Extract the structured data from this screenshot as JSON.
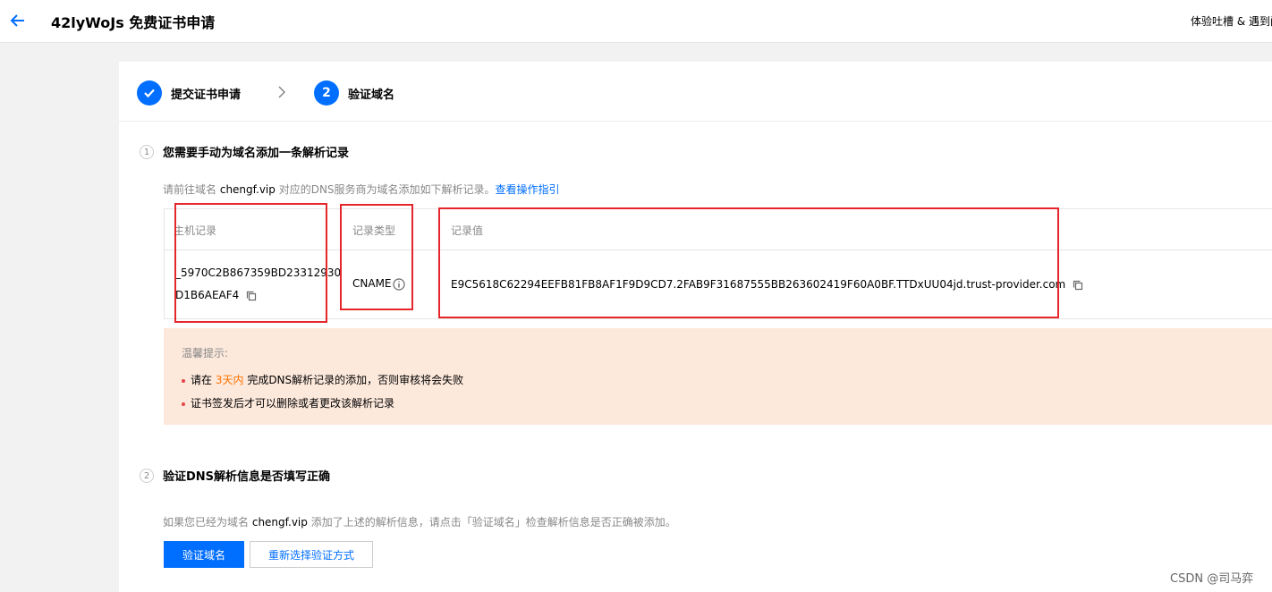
{
  "header": {
    "title": "42lyWoJs 免费证书申请",
    "feedback": "体验吐槽 & 遇到问"
  },
  "steps": [
    {
      "label": "提交证书申请",
      "state": "done"
    },
    {
      "number": "2",
      "label": "验证域名",
      "state": "active"
    }
  ],
  "section1": {
    "number": "1",
    "title": "您需要手动为域名添加一条解析记录",
    "hint_prefix": "请前往域名",
    "domain": "chengf.vip",
    "hint_suffix": "对应的DNS服务商为域名添加如下解析记录。",
    "guide_link": "查看操作指引",
    "table": {
      "headers": {
        "host": "主机记录",
        "type": "记录类型",
        "value": "记录值"
      },
      "row": {
        "host_line1": "_5970C2B867359BD23312930",
        "host_line2": "D1B6AEAF4",
        "type": "CNAME",
        "value": "E9C5618C62294EEFB81FB8AF1F9D9CD7.2FAB9F31687555BB263602419F60A0BF.TTDxUU04jd.trust-provider.com"
      }
    }
  },
  "tips": {
    "title": "温馨提示:",
    "item1_prefix": "请在",
    "item1_highlight": "3天内",
    "item1_suffix": "完成DNS解析记录的添加，否则审核将会失败",
    "item2": "证书签发后才可以删除或者更改该解析记录"
  },
  "section2": {
    "number": "2",
    "title": "验证DNS解析信息是否填写正确",
    "hint_prefix": "如果您已经为域名",
    "domain": "chengf.vip",
    "hint_suffix": "添加了上述的解析信息，请点击「验证域名」检查解析信息是否正确被添加。",
    "verify_button": "验证域名",
    "reselect_button": "重新选择验证方式"
  },
  "watermark": "CSDN @司马弈",
  "colors": {
    "accent": "#006eff",
    "highlight_box": "#e5262b",
    "tips_bg": "#fde9dc",
    "warning": "#ff7200"
  }
}
